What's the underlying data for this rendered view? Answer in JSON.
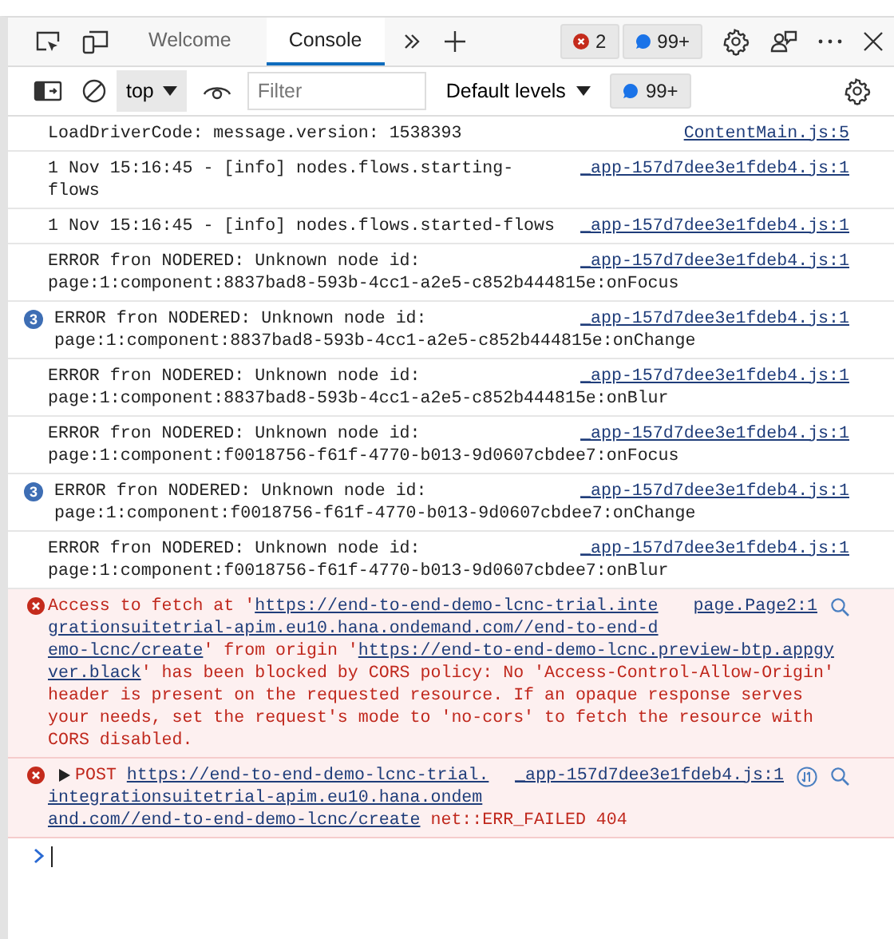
{
  "tabs": [
    {
      "label": "Welcome",
      "selected": false
    },
    {
      "label": "Console",
      "selected": true
    }
  ],
  "issue_counters": {
    "errors": "2",
    "messages": "99+"
  },
  "toolbar": {
    "context": "top",
    "filter": {
      "placeholder": "Filter"
    },
    "levels": "Default levels",
    "messages": "99+"
  },
  "messages": [
    {
      "kind": "log",
      "lines": [
        "LoadDriverCode: message.version: 1538393"
      ],
      "source": "ContentMain.js:5"
    },
    {
      "kind": "log",
      "lines": [
        "1 Nov 15:16:45 - [info] nodes.flows.starting-",
        "flows"
      ],
      "source": "_app-157d7dee3e1fdeb4.js:1"
    },
    {
      "kind": "log",
      "lines": [
        "1 Nov 15:16:45 - [info] nodes.flows.started-flows"
      ],
      "source": "_app-157d7dee3e1fdeb4.js:1"
    },
    {
      "kind": "log",
      "lines": [
        "ERROR fron NODERED: Unknown node id:",
        "page:1:component:8837bad8-593b-4cc1-a2e5-c852b444815e:onFocus"
      ],
      "source": "_app-157d7dee3e1fdeb4.js:1"
    },
    {
      "kind": "log",
      "repeat": "3",
      "lines": [
        "ERROR fron NODERED: Unknown node id:",
        "page:1:component:8837bad8-593b-4cc1-a2e5-c852b444815e:onChange"
      ],
      "source": "_app-157d7dee3e1fdeb4.js:1"
    },
    {
      "kind": "log",
      "lines": [
        "ERROR fron NODERED: Unknown node id:",
        "page:1:component:8837bad8-593b-4cc1-a2e5-c852b444815e:onBlur"
      ],
      "source": "_app-157d7dee3e1fdeb4.js:1"
    },
    {
      "kind": "log",
      "lines": [
        "ERROR fron NODERED: Unknown node id:",
        "page:1:component:f0018756-f61f-4770-b013-9d0607cbdee7:onFocus"
      ],
      "source": "_app-157d7dee3e1fdeb4.js:1"
    },
    {
      "kind": "log",
      "repeat": "3",
      "lines": [
        "ERROR fron NODERED: Unknown node id:",
        "page:1:component:f0018756-f61f-4770-b013-9d0607cbdee7:onChange"
      ],
      "source": "_app-157d7dee3e1fdeb4.js:1"
    },
    {
      "kind": "log",
      "lines": [
        "ERROR fron NODERED: Unknown node id:",
        "page:1:component:f0018756-f61f-4770-b013-9d0607cbdee7:onBlur"
      ],
      "source": "_app-157d7dee3e1fdeb4.js:1"
    },
    {
      "kind": "error",
      "lines": [
        [
          {
            "text": "Access to fetch at '",
            "link": false
          },
          {
            "text": "https://end-to-end-demo-lcnc-trial.inte",
            "link": true
          }
        ],
        [
          {
            "text": "grationsuitetrial-apim.eu10.hana.ondemand.com//end-to-end-d",
            "link": true
          }
        ],
        [
          {
            "text": "emo-lcnc/create",
            "link": true
          },
          {
            "text": "' from origin '",
            "link": false
          },
          {
            "text": "https://end-to-end-demo-lcnc.preview-btp.appgy",
            "link": true
          }
        ],
        [
          {
            "text": "ver.black",
            "link": true
          },
          {
            "text": "' has been blocked by CORS policy: No 'Access-Control-Allow-Origin'",
            "link": false
          }
        ],
        "header is present on the requested resource. If an opaque response serves",
        "your needs, set the request's mode to 'no-cors' to fetch the resource with",
        "CORS disabled."
      ],
      "source": "page.Page2:1"
    },
    {
      "kind": "network_error",
      "expanded": false,
      "lines": [
        [
          {
            "text": "POST ",
            "link": false
          },
          {
            "text": "https://end-to-end-demo-lcnc-trial.",
            "link": true
          }
        ],
        [
          {
            "text": "integrationsuitetrial-apim.eu10.hana.ondem",
            "link": true
          }
        ],
        [
          {
            "text": "and.com//end-to-end-demo-lcnc/create",
            "link": true
          },
          {
            "text": " net::ERR_FAILED 404",
            "link": false
          }
        ]
      ],
      "source": "_app-157d7dee3e1fdeb4.js:1"
    }
  ]
}
